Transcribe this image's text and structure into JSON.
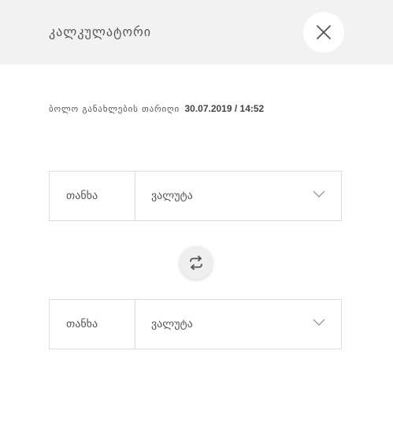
{
  "header": {
    "title": "კალკულატორი",
    "close_icon": "close-icon"
  },
  "last_update": {
    "label": "ბოლო განახლების თარიღი",
    "value": "30.07.2019 / 14:52"
  },
  "converter": {
    "from": {
      "amount_placeholder": "თანხა",
      "currency_placeholder": "ვალუტა",
      "dropdown_icon": "chevron-down-icon"
    },
    "swap_icon": "swap-arrows-icon",
    "to": {
      "amount_placeholder": "თანხა",
      "currency_placeholder": "ვალუტა",
      "dropdown_icon": "chevron-down-icon"
    }
  },
  "colors": {
    "header_bg": "#f2f2f2",
    "border": "#dcdcdc",
    "text": "#555555"
  }
}
